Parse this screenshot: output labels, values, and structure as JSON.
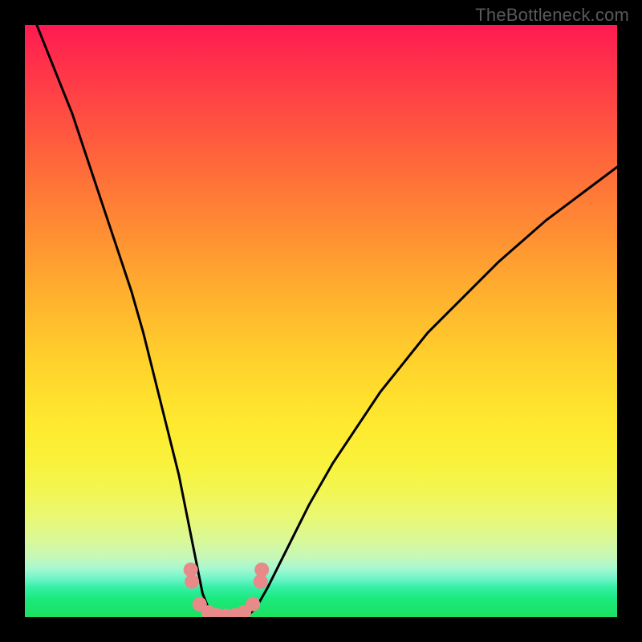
{
  "watermark": {
    "text": "TheBottleneck.com"
  },
  "chart_data": {
    "type": "line",
    "title": "",
    "xlabel": "",
    "ylabel": "",
    "xlim": [
      0,
      100
    ],
    "ylim": [
      0,
      100
    ],
    "grid": false,
    "legend": false,
    "series": [
      {
        "name": "bottleneck-curve",
        "color": "#000000",
        "x": [
          2,
          4,
          6,
          8,
          10,
          12,
          14,
          16,
          18,
          20,
          22,
          24,
          26,
          28,
          30,
          31,
          32,
          33,
          34,
          35,
          36,
          37,
          38,
          39,
          41,
          44,
          48,
          52,
          56,
          60,
          64,
          68,
          72,
          76,
          80,
          84,
          88,
          92,
          96,
          100
        ],
        "y": [
          100,
          95,
          90,
          85,
          79,
          73,
          67,
          61,
          55,
          48,
          40,
          32,
          24,
          14,
          4,
          1.5,
          0.6,
          0.2,
          0,
          0,
          0,
          0.2,
          0.6,
          1.5,
          5,
          11,
          19,
          26,
          32,
          38,
          43,
          48,
          52,
          56,
          60,
          63.5,
          67,
          70,
          73,
          76
        ]
      }
    ],
    "markers": {
      "name": "highlight-dots",
      "color": "#e88a8a",
      "x": [
        28.0,
        28.2,
        29.5,
        31.0,
        32.5,
        34.0,
        35.5,
        37.0,
        38.5,
        39.8,
        40.0
      ],
      "y": [
        8.0,
        6.0,
        2.2,
        0.8,
        0.3,
        0.2,
        0.3,
        0.8,
        2.2,
        6.0,
        8.0
      ]
    },
    "background_gradient": {
      "stops": [
        {
          "pos": 0,
          "color": "#ff1a52"
        },
        {
          "pos": 50,
          "color": "#ffb22e"
        },
        {
          "pos": 75,
          "color": "#f9f23c"
        },
        {
          "pos": 95,
          "color": "#36efa6"
        },
        {
          "pos": 100,
          "color": "#1de160"
        }
      ]
    }
  }
}
